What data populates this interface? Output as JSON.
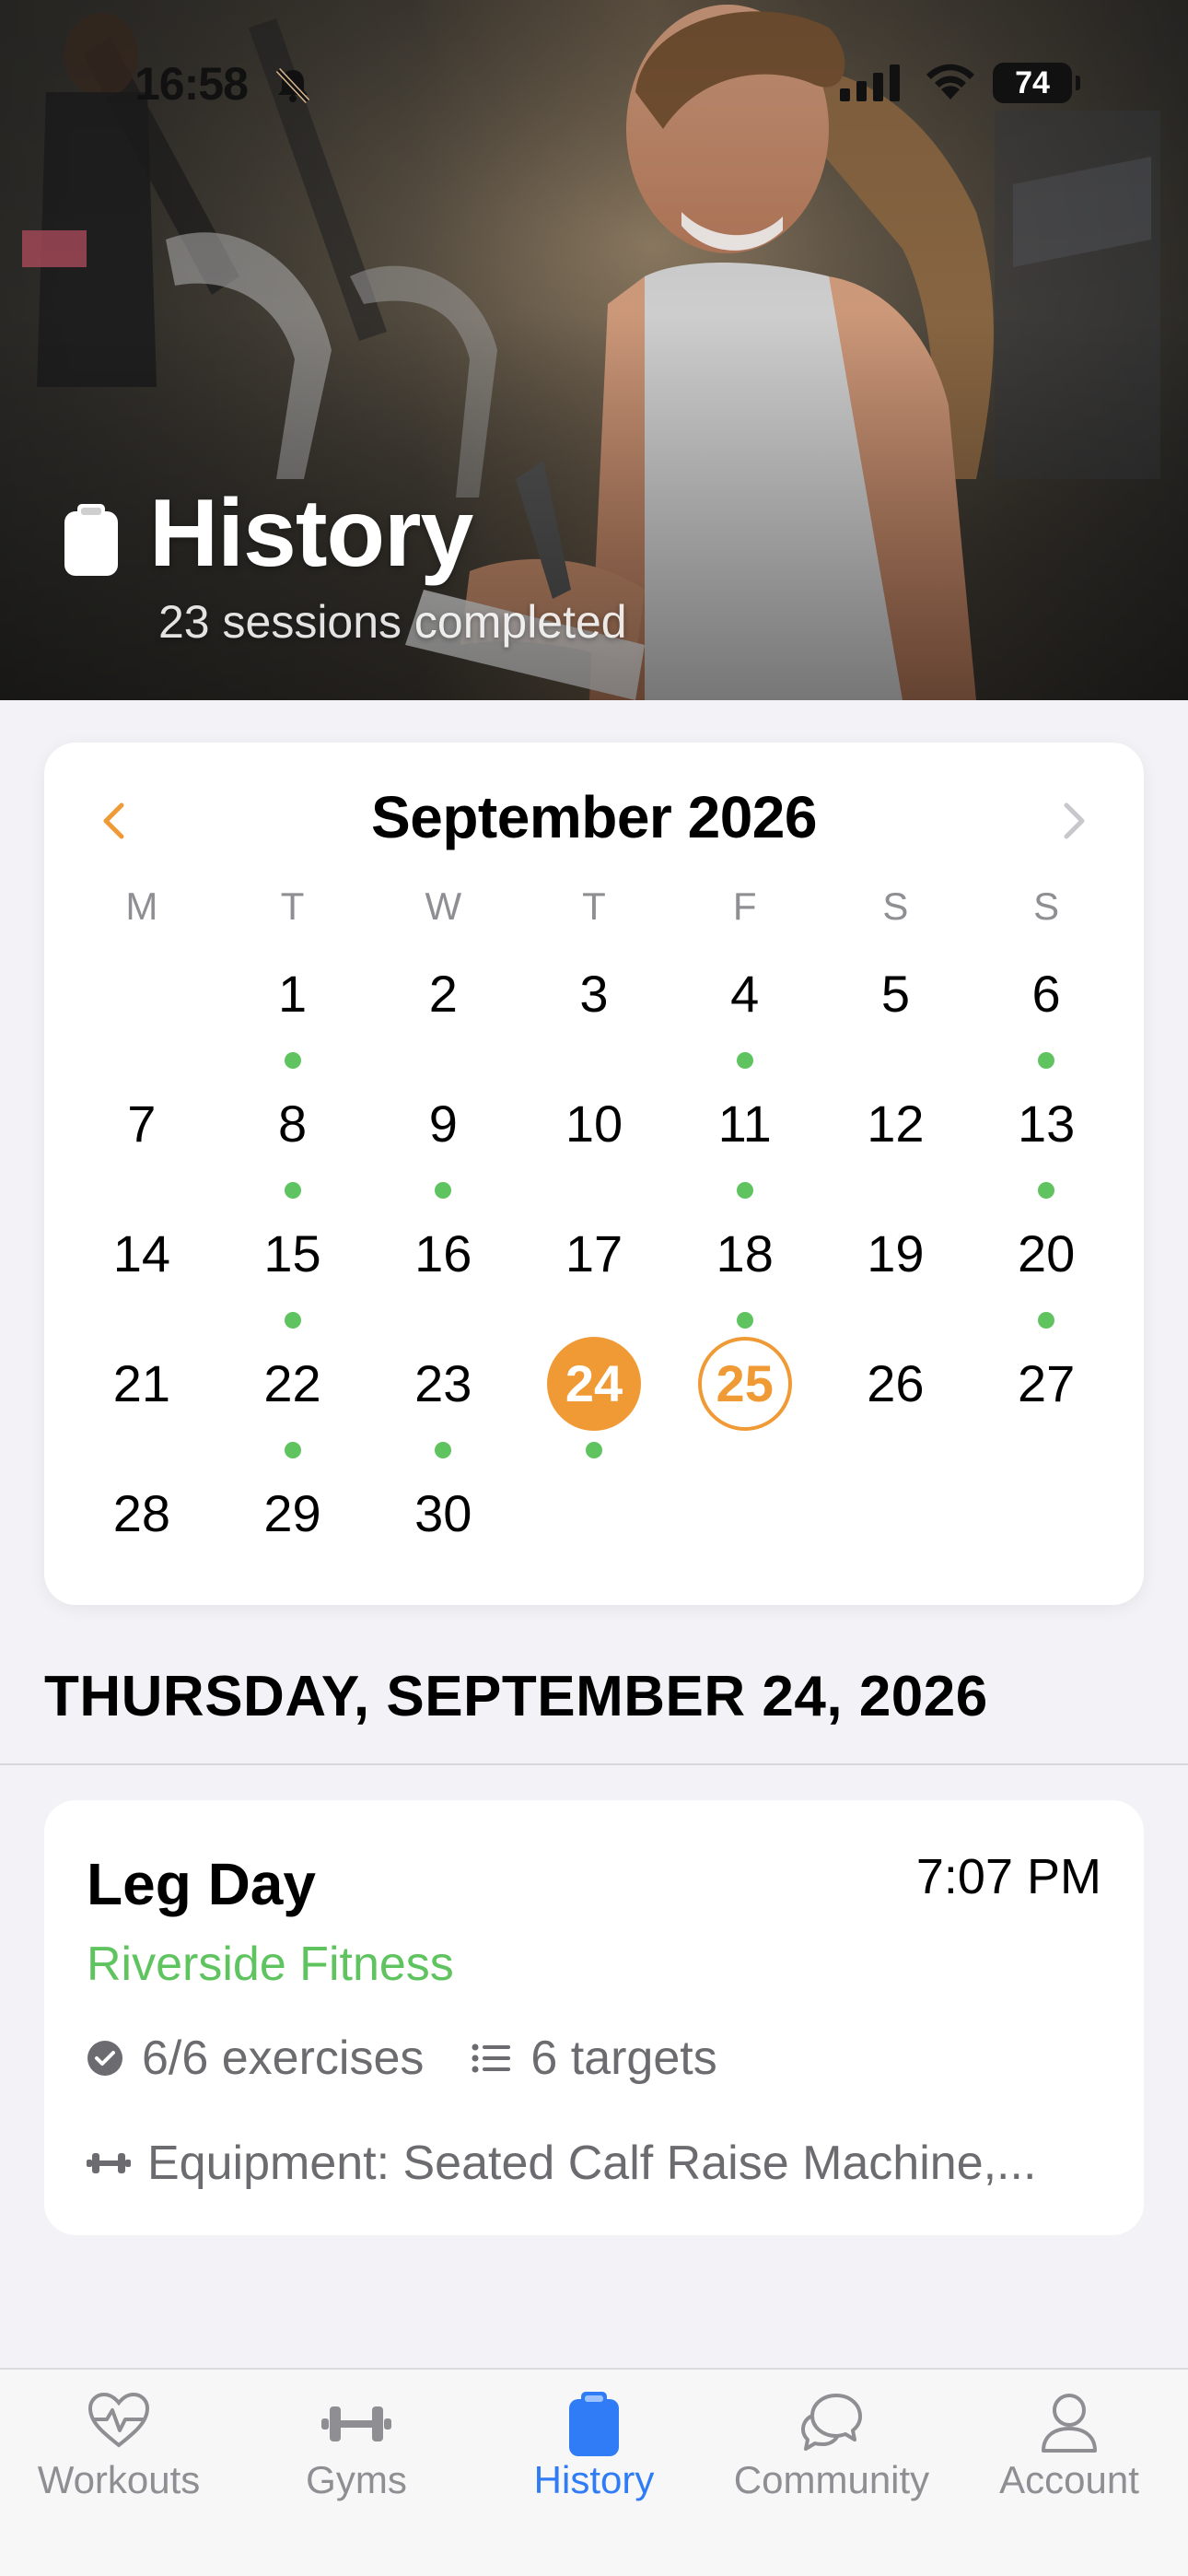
{
  "status_bar": {
    "time": "16:58",
    "battery": "74"
  },
  "hero": {
    "title": "History",
    "subtitle": "23 sessions completed",
    "icon": "clipboard-icon"
  },
  "calendar": {
    "month_label": "September 2026",
    "weekdays": [
      "M",
      "T",
      "W",
      "T",
      "F",
      "S",
      "S"
    ],
    "leading_blanks": 1,
    "days": [
      {
        "day": "1",
        "dot": true
      },
      {
        "day": "2",
        "dot": false
      },
      {
        "day": "3",
        "dot": false
      },
      {
        "day": "4",
        "dot": true
      },
      {
        "day": "5",
        "dot": false
      },
      {
        "day": "6",
        "dot": true
      },
      {
        "day": "7",
        "dot": false
      },
      {
        "day": "8",
        "dot": true
      },
      {
        "day": "9",
        "dot": true
      },
      {
        "day": "10",
        "dot": false
      },
      {
        "day": "11",
        "dot": true
      },
      {
        "day": "12",
        "dot": false
      },
      {
        "day": "13",
        "dot": true
      },
      {
        "day": "14",
        "dot": false
      },
      {
        "day": "15",
        "dot": true
      },
      {
        "day": "16",
        "dot": false
      },
      {
        "day": "17",
        "dot": false
      },
      {
        "day": "18",
        "dot": true
      },
      {
        "day": "19",
        "dot": false
      },
      {
        "day": "20",
        "dot": true
      },
      {
        "day": "21",
        "dot": false
      },
      {
        "day": "22",
        "dot": true
      },
      {
        "day": "23",
        "dot": true
      },
      {
        "day": "24",
        "dot": true,
        "state": "selected"
      },
      {
        "day": "25",
        "dot": false,
        "state": "today"
      },
      {
        "day": "26",
        "dot": false
      },
      {
        "day": "27",
        "dot": false
      },
      {
        "day": "28",
        "dot": false
      },
      {
        "day": "29",
        "dot": false
      },
      {
        "day": "30",
        "dot": false
      }
    ],
    "colors": {
      "accent": "#f09a36",
      "dot": "#5fc45f"
    }
  },
  "selected_date": {
    "heading": "THURSDAY, SEPTEMBER 24, 2026"
  },
  "session": {
    "title": "Leg Day",
    "time": "7:07 PM",
    "gym": "Riverside Fitness",
    "exercises": "6/6 exercises",
    "targets": "6 targets",
    "equipment": "Equipment: Seated Calf Raise Machine,..."
  },
  "tab_bar": {
    "tabs": [
      {
        "label": "Workouts",
        "icon": "heart-pulse-icon"
      },
      {
        "label": "Gyms",
        "icon": "dumbbell-icon"
      },
      {
        "label": "History",
        "icon": "clipboard-icon",
        "active": true
      },
      {
        "label": "Community",
        "icon": "chat-bubbles-icon"
      },
      {
        "label": "Account",
        "icon": "person-icon"
      }
    ],
    "active_color": "#2f7cf6"
  }
}
